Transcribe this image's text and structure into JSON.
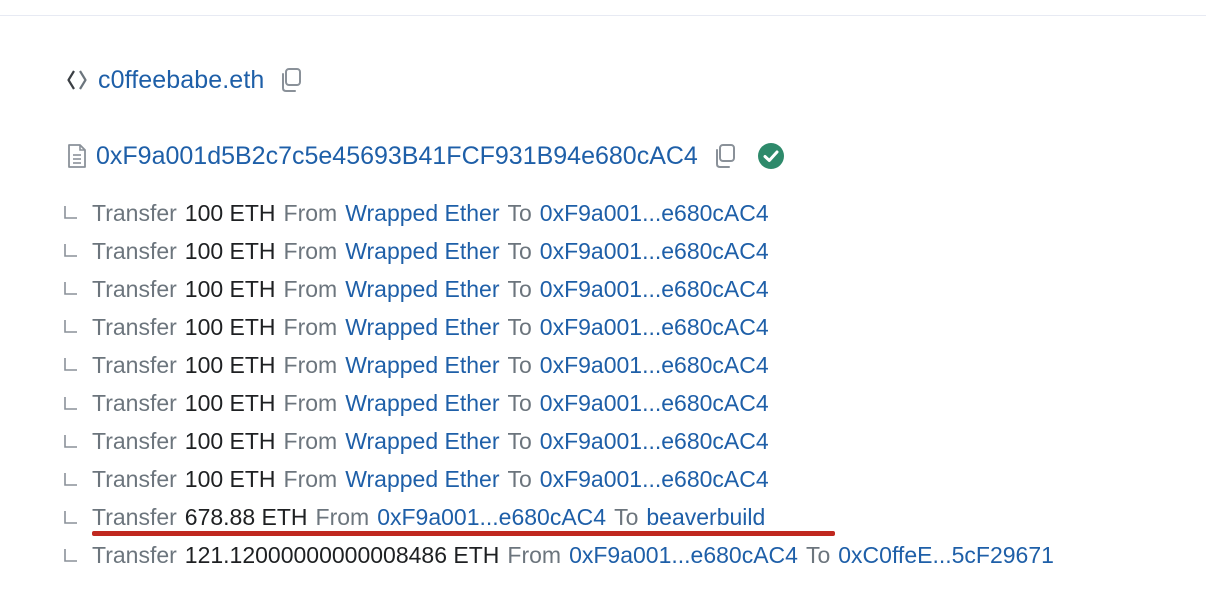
{
  "ens": {
    "name": "c0ffeebabe.eth",
    "icon": "ens-diamond-icon"
  },
  "contract": {
    "address": "0xF9a001d5B2c7c5e45693B41FCF931B94e680cAC4",
    "icon": "document-icon",
    "verified": true
  },
  "colors": {
    "link": "#1e5fa8",
    "muted": "#6c757d",
    "text": "#1e2022",
    "verified": "#2e8a6b",
    "highlight": "#c0281f"
  },
  "labels": {
    "transfer": "Transfer",
    "from": "From",
    "to": "To"
  },
  "transfers": [
    {
      "amount": "100 ETH",
      "from": "Wrapped Ether",
      "to": "0xF9a001...e680cAC4"
    },
    {
      "amount": "100 ETH",
      "from": "Wrapped Ether",
      "to": "0xF9a001...e680cAC4"
    },
    {
      "amount": "100 ETH",
      "from": "Wrapped Ether",
      "to": "0xF9a001...e680cAC4"
    },
    {
      "amount": "100 ETH",
      "from": "Wrapped Ether",
      "to": "0xF9a001...e680cAC4"
    },
    {
      "amount": "100 ETH",
      "from": "Wrapped Ether",
      "to": "0xF9a001...e680cAC4"
    },
    {
      "amount": "100 ETH",
      "from": "Wrapped Ether",
      "to": "0xF9a001...e680cAC4"
    },
    {
      "amount": "100 ETH",
      "from": "Wrapped Ether",
      "to": "0xF9a001...e680cAC4"
    },
    {
      "amount": "100 ETH",
      "from": "Wrapped Ether",
      "to": "0xF9a001...e680cAC4"
    },
    {
      "amount": "678.88 ETH",
      "from": "0xF9a001...e680cAC4",
      "to": "beaverbuild",
      "highlighted": true
    },
    {
      "amount": "121.12000000000008486 ETH",
      "from": "0xF9a001...e680cAC4",
      "to": "0xC0ffeE...5cF29671"
    }
  ]
}
